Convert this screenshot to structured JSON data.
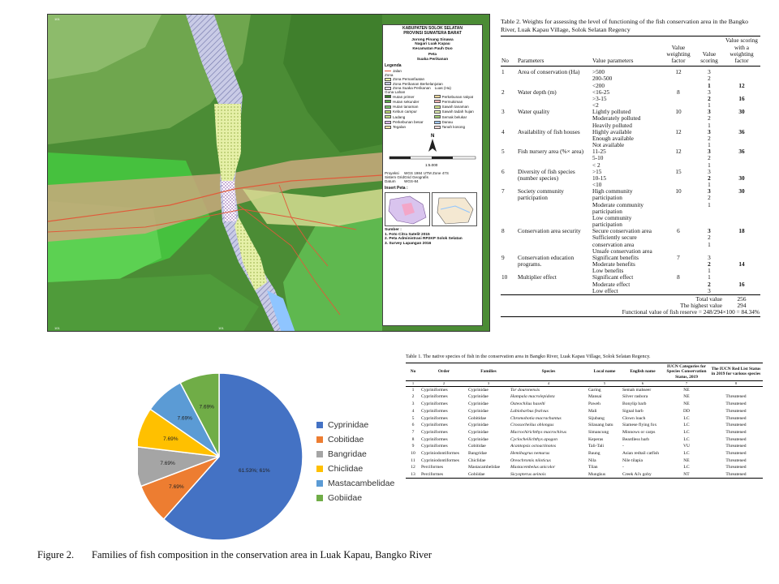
{
  "decor_colors": {
    "blue": "#c9d6ef",
    "gold": "#f6df9a",
    "blue_dark": "#a9bde5"
  },
  "map": {
    "title_lines": [
      "KABUPATEN SOLOK SELATAN",
      "PROVINSI SUMATERA BARAT"
    ],
    "location_lines": [
      "Jorong Pinang Sinawa",
      "Nagari Luak Kapau",
      "Kecamatan Pauh Duo"
    ],
    "map_title_lines": [
      "Peta",
      "Suaka Perikanan"
    ],
    "legend_heading": "Legenda",
    "legend_road": "Jalan",
    "legend_zone_heading": "Zona",
    "legend_zones": [
      "Zona Pemanfaatan",
      "Zona Perikanan Berkelanjutan",
      "Zona Suaka Perikanan"
    ],
    "legend_zone_extra": "Luas (Ha)",
    "legend_cover_heading": "Guna Lahan",
    "legend_cover": [
      {
        "label": "Hutan primer",
        "color": "#3a7d2c"
      },
      {
        "label": "Perkebunan rakyat",
        "color": "#e8d49a"
      },
      {
        "label": "Hutan sekunder",
        "color": "#5aa845"
      },
      {
        "label": "Permukiman",
        "color": "#f0b2b2"
      },
      {
        "label": "Hutan tanaman",
        "color": "#7cc66a"
      },
      {
        "label": "Sawah tanaman",
        "color": "#d6e98f"
      },
      {
        "label": "Kebun campur",
        "color": "#b8d46c"
      },
      {
        "label": "Sawah tadah hujan",
        "color": "#e2efb0"
      },
      {
        "label": "Ladang",
        "color": "#c4e08a"
      },
      {
        "label": "Semak belukar",
        "color": "#a7cf79"
      },
      {
        "label": "Perkebunan besar",
        "color": "#d9b8e8"
      },
      {
        "label": "Danau",
        "color": "#9fc5ef"
      },
      {
        "label": "Tegalan",
        "color": "#f3e3a6"
      },
      {
        "label": "Tanah kosong",
        "color": "#f2dada"
      }
    ],
    "scale_text": "1:5.000",
    "north_label": "N",
    "projection_rows": [
      {
        "label": "Proyeksi",
        "value": "WGS 1984 UTM Zone 47S"
      },
      {
        "label": "Sistem Grid",
        "value": "Grid Geografis"
      },
      {
        "label": "Datum",
        "value": "WGS-84"
      }
    ],
    "inset_heading": "Insert Peta :",
    "source_heading": "Sumber :",
    "source_items": [
      "1. Foto Citra Satelit 2015",
      "2. Peta Administrasi RP2KP Solok Selatan",
      "3. Survey Lapangan 2016"
    ],
    "coord_label": "101"
  },
  "table2": {
    "caption": "Table 2.  Weights for assessing the level of functioning of the fish conservation area in the Bangko River, Luak Kapau Village, Solok Selatan Regency",
    "headers": [
      "No",
      "Parameters",
      "Value parameters",
      "Value weighting factor",
      "Value scoring",
      "Value scoring with a weighting factor"
    ],
    "rows": [
      {
        "no": "1",
        "parameter": "Area of conservation (Ha)",
        "values": [
          ">500",
          "200-500",
          "<200"
        ],
        "weight": "12",
        "scores": [
          "3",
          "2",
          "1"
        ],
        "bold": 2,
        "total": "12"
      },
      {
        "no": "2",
        "parameter": "Water depth (m)",
        "values": [
          "<16-25",
          ">3-15",
          "<2"
        ],
        "weight": "8",
        "scores": [
          "3",
          "2",
          "1"
        ],
        "bold": 1,
        "total": "16"
      },
      {
        "no": "3",
        "parameter": "Water quality",
        "values": [
          "Lightly polluted",
          "Moderately polluted",
          "Heavily polluted"
        ],
        "weight": "10",
        "scores": [
          "3",
          "2",
          "1"
        ],
        "bold": 0,
        "total": "30"
      },
      {
        "no": "4",
        "parameter": "Availability of fish houses",
        "values": [
          "Highly available",
          "Enough available",
          "Not available"
        ],
        "weight": "12",
        "scores": [
          "3",
          "2",
          "1"
        ],
        "bold": 0,
        "total": "36"
      },
      {
        "no": "5",
        "parameter": "Fish nursery area (%× area)",
        "values": [
          "11-25",
          "5-10",
          "< 2"
        ],
        "weight": "12",
        "scores": [
          "3",
          "2",
          "1"
        ],
        "bold": 0,
        "total": "36"
      },
      {
        "no": "6",
        "parameter": "Diversity of fish species (number species)",
        "values": [
          ">15",
          "10-15",
          "<10"
        ],
        "weight": "15",
        "scores": [
          "3",
          "2",
          "1"
        ],
        "bold": 1,
        "total": "30"
      },
      {
        "no": "7",
        "parameter": "Society community participation",
        "values": [
          "High community participation",
          "Moderate community participation",
          "Low community participation"
        ],
        "weight": "10",
        "scores": [
          "3",
          "2",
          "1"
        ],
        "bold": 0,
        "total": "30"
      },
      {
        "no": "8",
        "parameter": "Conservation area security",
        "values": [
          "Secure conservation area",
          "Sufficiently secure conservation area",
          "Unsafe conservation area"
        ],
        "weight": "6",
        "scores": [
          "3",
          "2",
          "1"
        ],
        "bold": 0,
        "total": "18"
      },
      {
        "no": "9",
        "parameter": "Conservation education programs.",
        "values": [
          "Significant benefits",
          "Moderate benefits",
          "Low benefits"
        ],
        "weight": "7",
        "scores": [
          "3",
          "2",
          "1"
        ],
        "bold": 1,
        "total": "14"
      },
      {
        "no": "10",
        "parameter": "Multiplier effect",
        "values": [
          "Significant effect",
          "Moderate effect",
          "Low effect"
        ],
        "weight": "8",
        "scores": [
          "1",
          "2",
          "3"
        ],
        "bold": 1,
        "total": "16"
      }
    ],
    "total_label": "Total value",
    "total_value": "256",
    "highest_label": "The highest value",
    "highest_value": "294",
    "functional_label": "Functional value of fish reserve = 248/294×100 = 84.34%"
  },
  "chart_data": {
    "type": "pie",
    "categories": [
      "Cyprinidae",
      "Cobitidae",
      "Bangridae",
      "Chiclidae",
      "Mastacambelidae",
      "Gobiidae"
    ],
    "values": [
      61.53,
      7.69,
      7.69,
      7.69,
      7.69,
      7.69
    ],
    "data_labels": [
      "61.53%; 61%",
      "7.69%",
      "7.69%",
      "7.69%",
      "7.69%",
      "7.69%"
    ],
    "colors": [
      "#4472c4",
      "#ed7d31",
      "#a5a5a5",
      "#ffc000",
      "#5b9bd5",
      "#70ad47"
    ],
    "legend_position": "right"
  },
  "table1": {
    "caption": "Table 1. The native species of fish in the conservation area in Bangko River, Luak Kapau Village, Solok Selatan Regency.",
    "headers": [
      "No",
      "Order",
      "Families",
      "Species",
      "Local name",
      "English name",
      "IUCN Categories for Species Conservation Status, 2019",
      "The IUCN Red List Status in 2019 for various species"
    ],
    "col_numbers": [
      "1",
      "2",
      "3",
      "4",
      "5",
      "6",
      "7",
      "8"
    ],
    "rows": [
      [
        "1",
        "Cypriniformes",
        "Cyprinidae",
        "Tor douronensis",
        "Garing",
        "Semah mahseer",
        "NE",
        ""
      ],
      [
        "2",
        "Cypriniformes",
        "Cyprinidae",
        "Hampala macrolepidota",
        "Mansai",
        "Silver rasbora",
        "NE",
        "Threatened"
      ],
      [
        "3",
        "Cypriniformes",
        "Cyprinidae",
        "Osteochilus haselti",
        "Paweh",
        "Bonylip barb",
        "NE",
        "Threatened"
      ],
      [
        "4",
        "Cypriniformes",
        "Cyprinidae",
        "Labiobarbus festivus",
        "Mali",
        "Signal barb",
        "DD",
        "Threatened"
      ],
      [
        "5",
        "Cypriniformes",
        "Gobitidae",
        "Chromobotia macrachantus",
        "Sijubang",
        "Clown loach",
        "LC",
        "Threatened"
      ],
      [
        "6",
        "Cypriniformes",
        "Cyprinidae",
        "Crossocheilus oblongus",
        "Silauang batu",
        "Siamese flying fox",
        "LC",
        "Threatened"
      ],
      [
        "7",
        "Cypriniformes",
        "Cyprinidae",
        "Macrochirichthys macrochirus",
        "Simancung",
        "Minnows or carps",
        "LC",
        "Threatened"
      ],
      [
        "8",
        "Cypriniformes",
        "Cyprinidae",
        "Cyclocheilichthys apogon",
        "Keperas",
        "Beardless barb",
        "LC",
        "Threatened"
      ],
      [
        "9",
        "Cypriniformes",
        "Cobitidae",
        "Acantopsis octoactinotos",
        "Tali-Tali",
        "-",
        "VU",
        "Threatened"
      ],
      [
        "10",
        "Cypriniodontiformes",
        "Bangridae",
        "Hemibagrus nemurus",
        "Baung",
        "Asian redtail catfish",
        "LC",
        "Threatened"
      ],
      [
        "11",
        "Cypriniodontiformes",
        "Chiclidae",
        "Oreochromis niloticus",
        "Nila",
        "Nile tilapia",
        "NE",
        "Threatened"
      ],
      [
        "12",
        "Perciformes",
        "Mastacambelidae",
        "Mastacembelus unicolor",
        "Tilan",
        "-",
        "LC",
        "Threatened"
      ],
      [
        "13",
        "Perciformes",
        "Gobiidae",
        "Sicyopterus aeinois",
        "Mungkus",
        "Creek Ai's goby",
        "NT",
        "Threatened"
      ]
    ]
  },
  "figure_caption": {
    "label": "Figure 2.",
    "text": "Families of fish composition in the conservation area in Luak Kapau, Bangko River"
  }
}
